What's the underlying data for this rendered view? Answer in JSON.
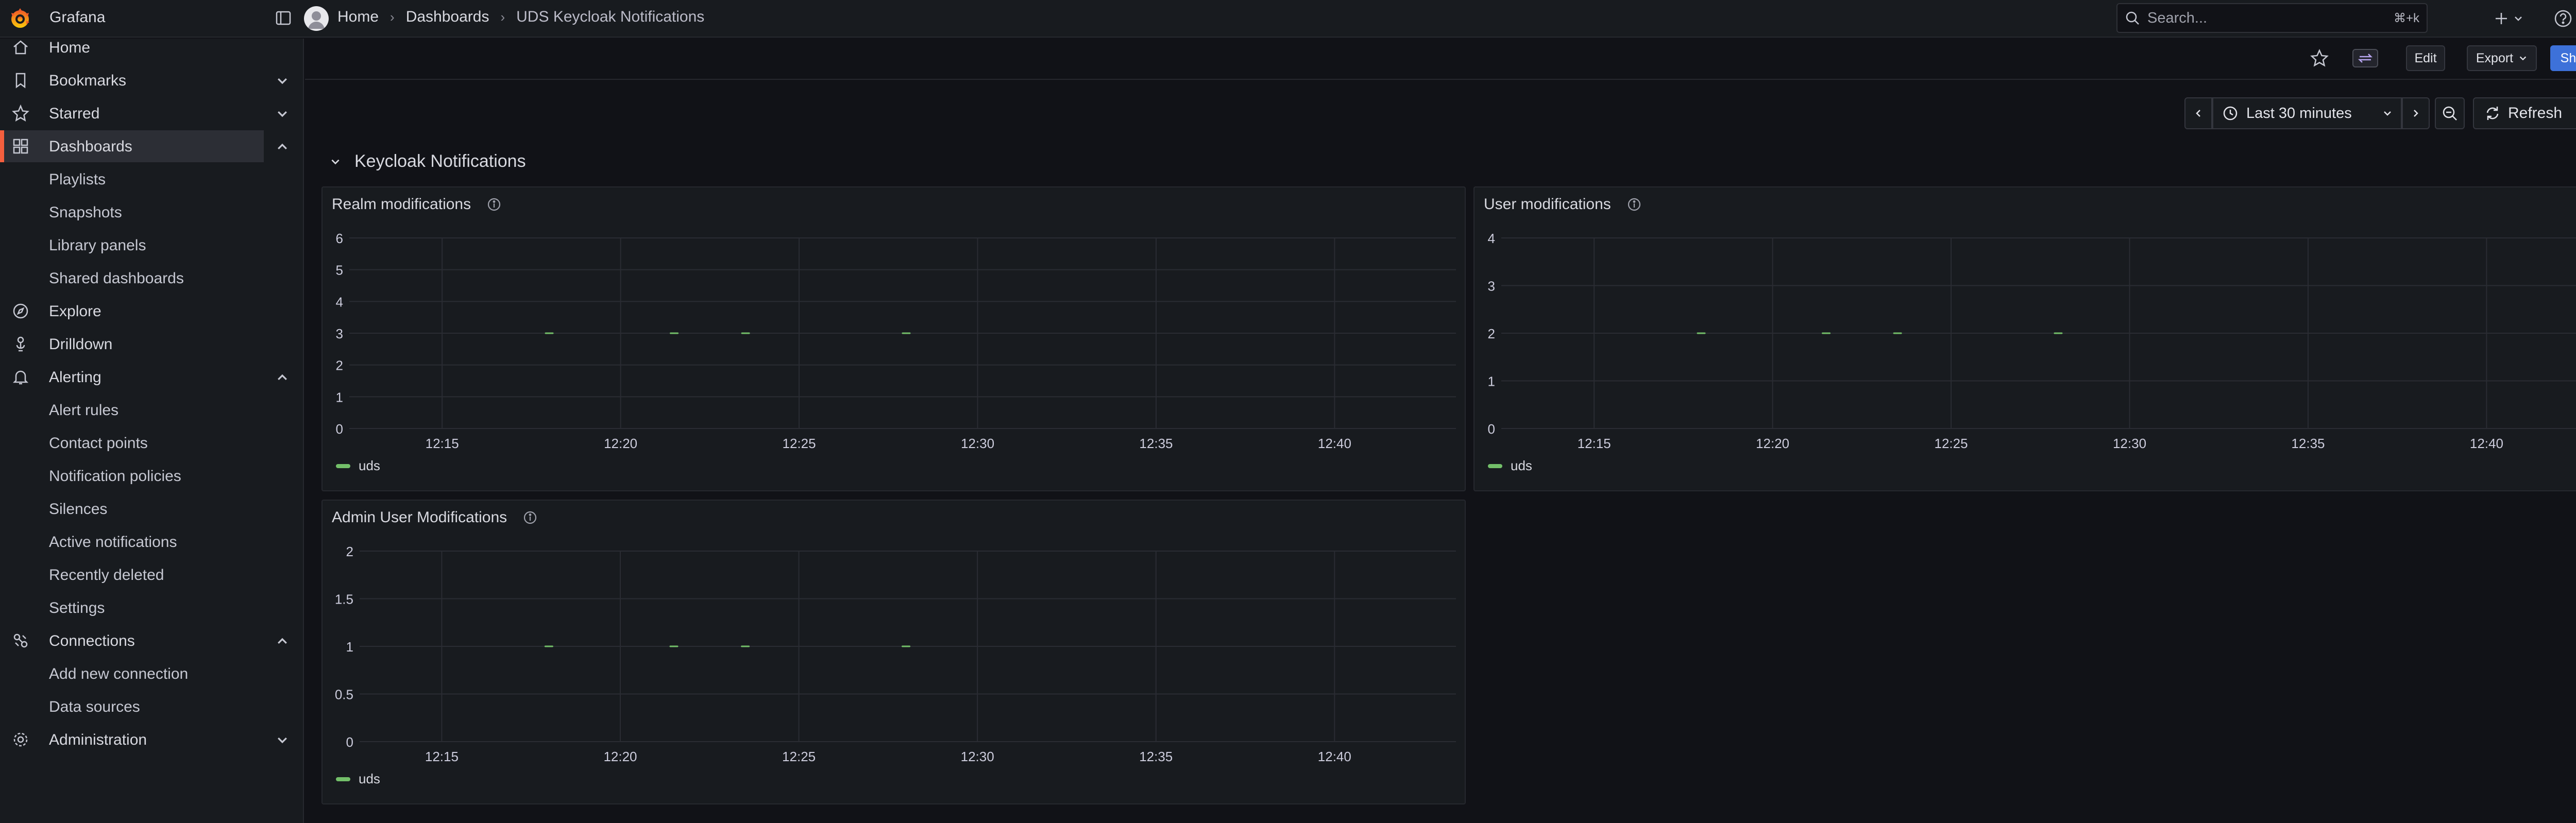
{
  "app": {
    "name": "Grafana"
  },
  "breadcrumbs": [
    "Home",
    "Dashboards",
    "UDS Keycloak Notifications"
  ],
  "search": {
    "placeholder": "Search...",
    "shortcut": "⌘+k"
  },
  "toolbar": {
    "edit_label": "Edit",
    "export_label": "Export",
    "share_label": "Share"
  },
  "sidebar": {
    "items": [
      {
        "label": "Home",
        "icon": "home-icon",
        "chevron": ""
      },
      {
        "label": "Bookmarks",
        "icon": "bookmark-icon",
        "chevron": "down"
      },
      {
        "label": "Starred",
        "icon": "star-icon",
        "chevron": "down"
      },
      {
        "label": "Dashboards",
        "icon": "apps-icon",
        "chevron": "up",
        "active": true
      },
      {
        "label": "Playlists",
        "sub": true
      },
      {
        "label": "Snapshots",
        "sub": true
      },
      {
        "label": "Library panels",
        "sub": true
      },
      {
        "label": "Shared dashboards",
        "sub": true
      },
      {
        "label": "Explore",
        "icon": "compass-icon",
        "chevron": ""
      },
      {
        "label": "Drilldown",
        "icon": "drilldown-icon",
        "chevron": ""
      },
      {
        "label": "Alerting",
        "icon": "bell-icon",
        "chevron": "up"
      },
      {
        "label": "Alert rules",
        "sub": true
      },
      {
        "label": "Contact points",
        "sub": true
      },
      {
        "label": "Notification policies",
        "sub": true
      },
      {
        "label": "Silences",
        "sub": true
      },
      {
        "label": "Active notifications",
        "sub": true
      },
      {
        "label": "Recently deleted",
        "sub": true
      },
      {
        "label": "Settings",
        "sub": true
      },
      {
        "label": "Connections",
        "icon": "connections-icon",
        "chevron": "up"
      },
      {
        "label": "Add new connection",
        "sub": true
      },
      {
        "label": "Data sources",
        "sub": true
      },
      {
        "label": "Administration",
        "icon": "cog-icon",
        "chevron": "down"
      }
    ]
  },
  "time_controls": {
    "range_label": "Last 30 minutes",
    "refresh_label": "Refresh"
  },
  "row": {
    "title": "Keycloak Notifications"
  },
  "colors": {
    "accent": "#f55f3e",
    "series": "#73bf69",
    "primary": "#3d71d9"
  },
  "chart_data": [
    {
      "type": "line",
      "title": "Realm modifications",
      "x_ticks": [
        "12:15",
        "12:20",
        "12:25",
        "12:30",
        "12:35",
        "12:40"
      ],
      "y_ticks": [
        "0",
        "1",
        "2",
        "3",
        "4",
        "5",
        "6"
      ],
      "ylim": [
        0,
        6
      ],
      "xlim_minutes": [
        12.4,
        43.4
      ],
      "series": [
        {
          "name": "uds",
          "points": [
            {
              "x": "12:18",
              "y": 3
            },
            {
              "x": "12:21.5",
              "y": 3
            },
            {
              "x": "12:23.5",
              "y": 3
            },
            {
              "x": "12:28",
              "y": 3
            }
          ]
        }
      ],
      "legend": "bottom-left",
      "grid": true
    },
    {
      "type": "line",
      "title": "User modifications",
      "x_ticks": [
        "12:15",
        "12:20",
        "12:25",
        "12:30",
        "12:35",
        "12:40"
      ],
      "y_ticks": [
        "0",
        "1",
        "2",
        "3",
        "4"
      ],
      "ylim": [
        0,
        4
      ],
      "xlim_minutes": [
        12.4,
        43.4
      ],
      "series": [
        {
          "name": "uds",
          "points": [
            {
              "x": "12:18",
              "y": 2
            },
            {
              "x": "12:21.5",
              "y": 2
            },
            {
              "x": "12:23.5",
              "y": 2
            },
            {
              "x": "12:28",
              "y": 2
            }
          ]
        }
      ],
      "legend": "bottom-left",
      "grid": true
    },
    {
      "type": "line",
      "title": "Admin User Modifications",
      "x_ticks": [
        "12:15",
        "12:20",
        "12:25",
        "12:30",
        "12:35",
        "12:40"
      ],
      "y_ticks": [
        "0",
        "0.5",
        "1",
        "1.5",
        "2"
      ],
      "ylim": [
        0,
        2
      ],
      "xlim_minutes": [
        12.7,
        43.4
      ],
      "series": [
        {
          "name": "uds",
          "points": [
            {
              "x": "12:18",
              "y": 1
            },
            {
              "x": "12:21.5",
              "y": 1
            },
            {
              "x": "12:23.5",
              "y": 1
            },
            {
              "x": "12:28",
              "y": 1
            }
          ]
        }
      ],
      "legend": "bottom-left",
      "grid": true
    }
  ]
}
